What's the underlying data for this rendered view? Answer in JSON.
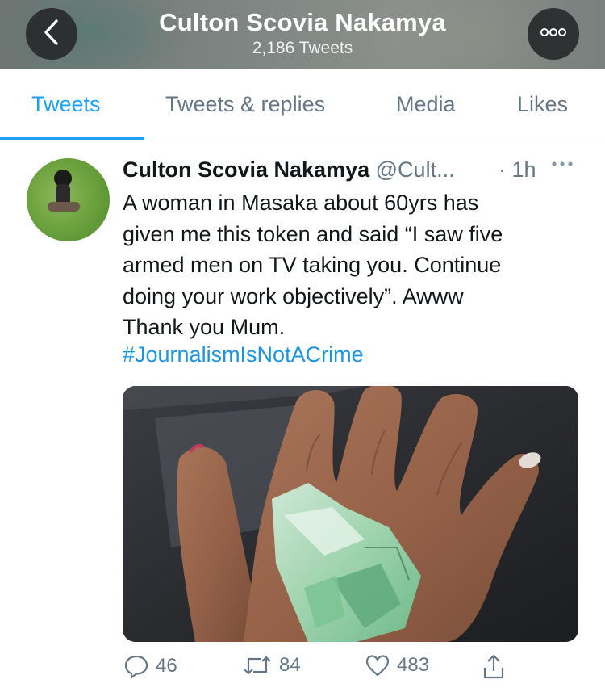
{
  "header": {
    "title": "Culton Scovia Nakamya",
    "subtitle": "2,186 Tweets"
  },
  "tabs": [
    {
      "label": "Tweets",
      "active": true
    },
    {
      "label": "Tweets & replies",
      "active": false
    },
    {
      "label": "Media",
      "active": false
    },
    {
      "label": "Likes",
      "active": false
    }
  ],
  "tweet": {
    "author_name": "Culton Scovia Nakamya",
    "author_handle": "@Cult...",
    "time": "· 1h",
    "text_lines": [
      "A woman in Masaka about 60yrs has",
      "given me this token and said “I saw five",
      "armed men on TV taking you. Continue",
      "doing your work objectively”.  Awww",
      "Thank you Mum."
    ],
    "hashtag": "#JournalismIsNotACrime",
    "replies": "46",
    "retweets": "84",
    "likes": "483"
  },
  "icons": {
    "back": "chevron-left-icon",
    "more": "more-icon",
    "reply": "reply-icon",
    "retweet": "retweet-icon",
    "like": "heart-icon",
    "share": "share-icon"
  },
  "colors": {
    "accent": "#1da1f2",
    "hashtag": "#1b95e0",
    "secondary_text": "#657786"
  }
}
